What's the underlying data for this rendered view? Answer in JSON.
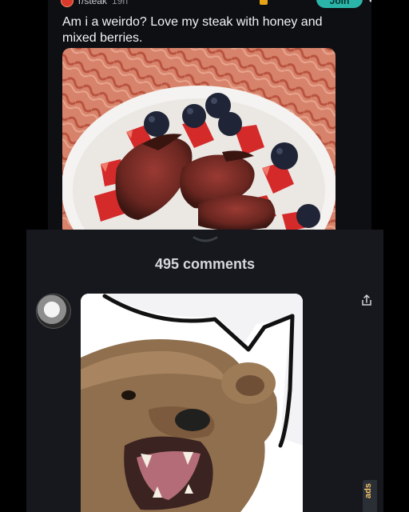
{
  "post": {
    "subreddit": "r/steak",
    "age": "19h",
    "join_label": "Join",
    "more_icon": "more-dots-icon",
    "title": "Am i a weirdo? Love my steak with honey and mixed berries."
  },
  "comments": {
    "count_label": "495 comments",
    "share_icon": "share-icon",
    "handle_icon": "chevron-down-icon"
  },
  "side_tab": {
    "label": "ads"
  },
  "colors": {
    "join_button": "#2bb5a8",
    "post_background": "#0d0f13",
    "sheet_background": "#16181d",
    "accent_orange": "#e8a417"
  }
}
